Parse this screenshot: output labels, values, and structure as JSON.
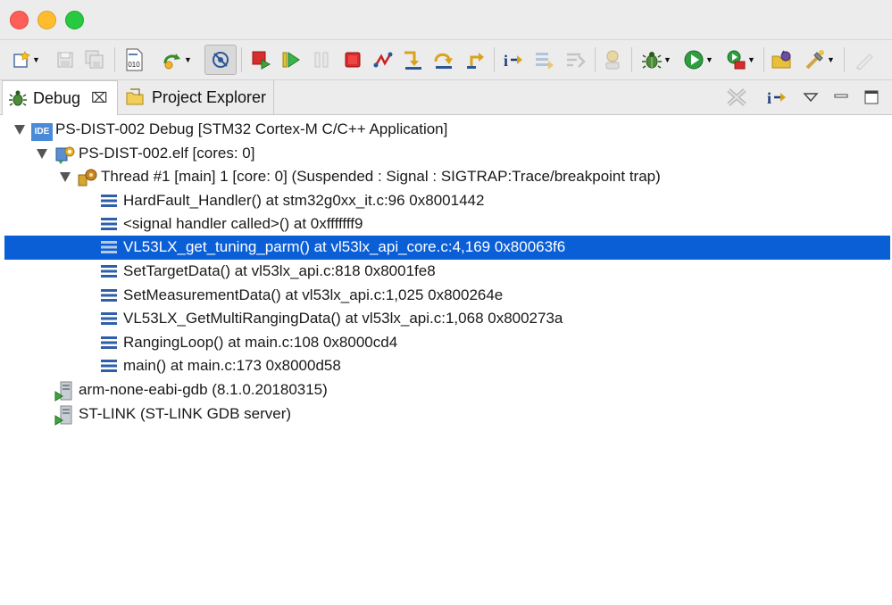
{
  "tabs": {
    "debug_label": "Debug",
    "project_explorer_label": "Project Explorer"
  },
  "tree": {
    "launch": "PS-DIST-002 Debug [STM32 Cortex-M C/C++ Application]",
    "elf": "PS-DIST-002.elf [cores: 0]",
    "thread": "Thread #1 [main] 1 [core: 0] (Suspended : Signal : SIGTRAP:Trace/breakpoint trap)",
    "frames": [
      "HardFault_Handler() at stm32g0xx_it.c:96 0x8001442",
      "<signal handler called>() at 0xfffffff9",
      "VL53LX_get_tuning_parm() at vl53lx_api_core.c:4,169 0x80063f6",
      "SetTargetData() at vl53lx_api.c:818 0x8001fe8",
      "SetMeasurementData() at vl53lx_api.c:1,025 0x800264e",
      "VL53LX_GetMultiRangingData() at vl53lx_api.c:1,068 0x800273a",
      "RangingLoop() at main.c:108 0x8000cd4",
      "main() at main.c:173 0x8000d58"
    ],
    "gdb": "arm-none-eabi-gdb (8.1.0.20180315)",
    "stlink": "ST-LINK (ST-LINK GDB server)",
    "ide_badge": "IDE"
  },
  "icons": {
    "toolbar": [
      "new-icon",
      "save-icon",
      "save-all-icon",
      "binary-icon",
      "skip-icon",
      "disconnect-icon",
      "terminate-relaunch-icon",
      "resume-icon",
      "suspend-icon",
      "terminate-icon",
      "disconnect-debug-icon",
      "step-into-icon",
      "step-over-icon",
      "step-return-icon",
      "instruction-step-icon",
      "drop-frame-icon",
      "use-step-filters-icon",
      "restart-icon",
      "debug-icon",
      "run-icon",
      "external-tools-icon",
      "open-perspective-icon",
      "build-icon",
      "pen-icon"
    ],
    "tab": [
      "bug-icon",
      "folder-icon"
    ],
    "view": [
      "remove-terminated-icon",
      "instruction-step-mode-icon",
      "view-menu-icon",
      "minimize-icon",
      "maximize-icon"
    ]
  },
  "colors": {
    "selection": "#0b5fd6",
    "close": "#fe5f57",
    "minimize": "#febc2e",
    "maximize": "#28c840"
  }
}
